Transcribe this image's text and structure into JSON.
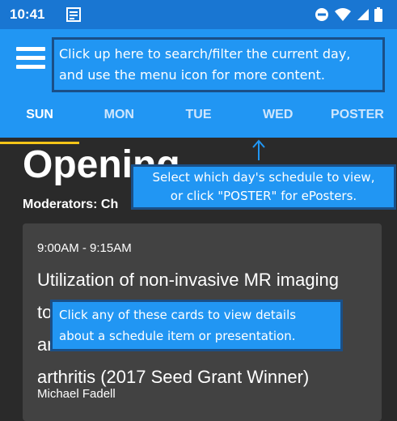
{
  "status_bar": {
    "time": "10:41"
  },
  "tabs": [
    "SUN",
    "MON",
    "TUE",
    "WED",
    "POSTER"
  ],
  "session": {
    "title": "Opening",
    "moderators": "Moderators: Ch"
  },
  "card": {
    "time": "9:00AM - 9:15AM",
    "title_lines": [
      "Utilization of non-invasive MR imaging",
      "to",
      "ar",
      "arthritis (2017 Seed Grant Winner)"
    ],
    "author": "Michael Fadell"
  },
  "tooltips": {
    "top": [
      "Click up here to search/filter the current day,",
      "and use the menu icon for more content."
    ],
    "mid": [
      "Select which day's schedule to view,",
      "or click \"POSTER\" for ePosters."
    ],
    "low": [
      "Click any of these cards to view details",
      "about a schedule item or presentation."
    ]
  },
  "colors": {
    "primary": "#2196f3",
    "status": "#1976d2",
    "indicator": "#f5c518",
    "background": "#2a2a2a",
    "card": "#424242"
  },
  "icons": [
    "notification-icon",
    "do-not-disturb-icon",
    "wifi-icon",
    "signal-icon",
    "battery-icon",
    "menu-icon",
    "arrow-up-icon"
  ]
}
